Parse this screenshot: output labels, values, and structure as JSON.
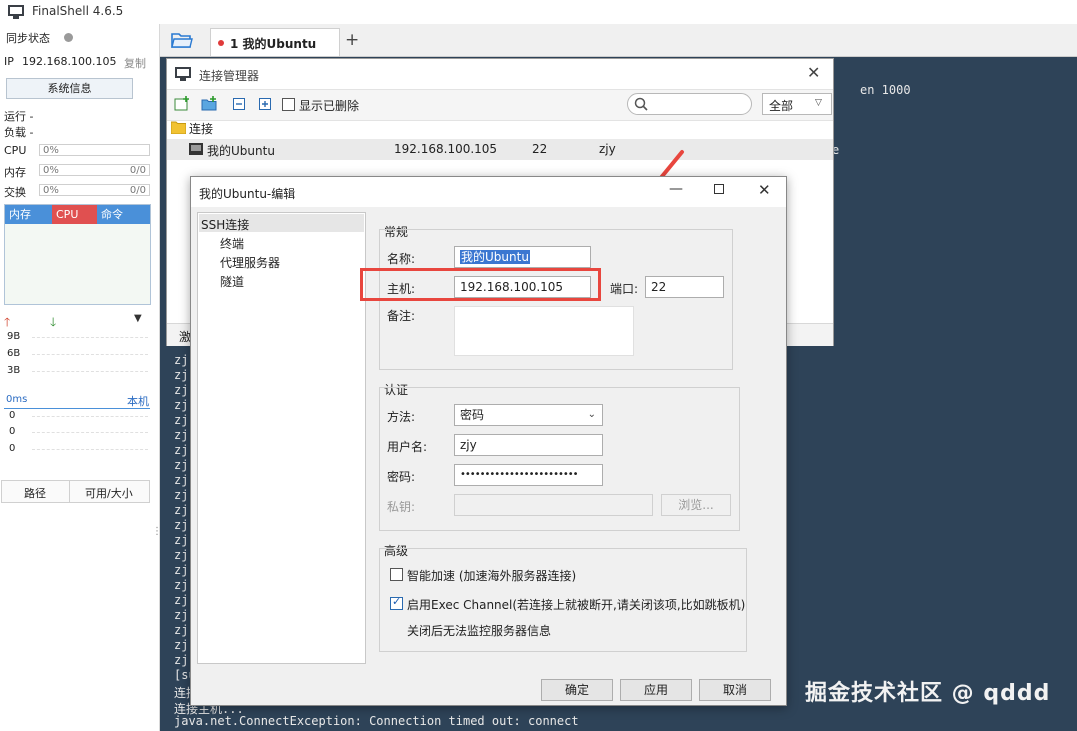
{
  "app": {
    "title": "FinalShell 4.6.5"
  },
  "sidebar": {
    "sync_label": "同步状态",
    "ip_label": "IP",
    "ip_value": "192.168.100.105",
    "copy_label": "复制",
    "sysinfo_button": "系统信息",
    "run_label": "运行 -",
    "load_label": "负载 -",
    "cpu_label": "CPU",
    "cpu_value": "0%",
    "mem_label": "内存",
    "mem_value": "0%",
    "mem_ratio": "0/0",
    "swap_label": "交换",
    "swap_value": "0%",
    "swap_ratio": "0/0",
    "tabs": [
      "内存",
      "CPU",
      "命令"
    ],
    "net_levels": [
      "9B",
      "6B",
      "3B"
    ],
    "latency_label": "0ms",
    "local_label": "本机",
    "latency_values": [
      "0",
      "0",
      "0"
    ],
    "disk_headers": [
      "路径",
      "可用/大小"
    ]
  },
  "tabs": [
    {
      "label": "1 我的Ubuntu"
    }
  ],
  "terminal": {
    "lines": [
      "zj",
      "zj",
      "zj",
      "zj",
      "zj",
      "zj",
      "zj",
      "zj",
      "zj",
      "zj",
      "zj",
      "zj",
      "zj",
      "zj",
      "zj",
      "zj",
      "zj",
      "zj",
      "zj",
      "zj",
      "zj",
      "[su"
    ],
    "bottom_lines": [
      "连接",
      "连接主机...",
      "java.net.ConnectException: Connection timed out: connect"
    ],
    "right_fragment_1": "en 1000",
    "right_fragment_2": "e"
  },
  "connmgr": {
    "title": "连接管理器",
    "show_deleted": "显示已删除",
    "filter_selected": "全部",
    "folder_label": "连接",
    "row": {
      "name": "我的Ubuntu",
      "host": "192.168.100.105",
      "port": "22",
      "user": "zjy"
    },
    "bottom_fragment": "激"
  },
  "edit": {
    "title": "我的Ubuntu-编辑",
    "nav": [
      "SSH连接",
      "终端",
      "代理服务器",
      "隧道"
    ],
    "general_label": "常规",
    "name_label": "名称:",
    "name_value": "我的Ubuntu",
    "host_label": "主机:",
    "host_value": "192.168.100.105",
    "port_label": "端口:",
    "port_value": "22",
    "note_label": "备注:",
    "auth_label": "认证",
    "method_label": "方法:",
    "method_value": "密码",
    "user_label": "用户名:",
    "user_value": "zjy",
    "pass_label": "密码:",
    "pass_value": "••••••••••••••••••••••••",
    "key_label": "私钥:",
    "browse_label": "浏览...",
    "advanced_label": "高级",
    "accel_label": "智能加速 (加速海外服务器连接)",
    "exec_label": "启用Exec Channel(若连接上就被断开,请关闭该项,比如跳板机)",
    "exec_note": "关闭后无法监控服务器信息",
    "ok_label": "确定",
    "apply_label": "应用",
    "cancel_label": "取消"
  },
  "watermark": "掘金技术社区 @ qddd",
  "colors": {
    "accent_blue": "#4a90d9",
    "tab_cpu": "#e05050",
    "tab_cmd": "#cc6f4a",
    "highlight_red": "#e8463e",
    "terminal_bg": "#2e4358"
  }
}
